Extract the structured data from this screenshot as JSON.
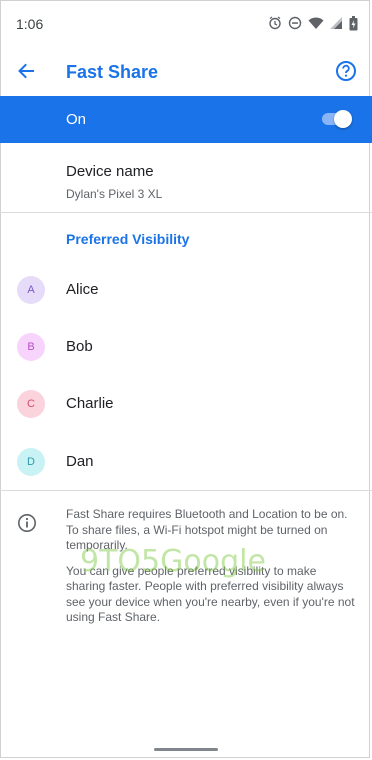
{
  "status_bar": {
    "time": "1:06",
    "icons": [
      "alarm-icon",
      "do-not-disturb-icon",
      "wifi-icon",
      "signal-icon",
      "battery-icon"
    ]
  },
  "app_bar": {
    "title": "Fast Share",
    "back_icon": "arrow-back-icon",
    "help_icon": "help-icon"
  },
  "master_switch": {
    "label": "On",
    "state": true
  },
  "device": {
    "title": "Device name",
    "value": "Dylan's Pixel 3 XL"
  },
  "section": {
    "title": "Preferred Visibility"
  },
  "contacts": [
    {
      "initial": "A",
      "name": "Alice",
      "bg": "#e6dcf9",
      "fg": "#7a56c2"
    },
    {
      "initial": "B",
      "name": "Bob",
      "bg": "#f7d4fb",
      "fg": "#b64fc4"
    },
    {
      "initial": "C",
      "name": "Charlie",
      "bg": "#fbd3dc",
      "fg": "#d64b6e"
    },
    {
      "initial": "D",
      "name": "Dan",
      "bg": "#c9f2f4",
      "fg": "#2e9aa6"
    }
  ],
  "info": {
    "icon": "info-icon",
    "paragraph1": "Fast Share requires Bluetooth and Location to be on. To share files, a Wi-Fi hotspot might be turned on temporarily.",
    "paragraph2": "You can give people preferred visibility to make sharing faster. People with preferred visibility always see your device when you're nearby, even if you're not using Fast Share."
  },
  "watermark": "9TO5Google",
  "colors": {
    "accent": "#1a73e8",
    "divider": "#dadce0"
  }
}
